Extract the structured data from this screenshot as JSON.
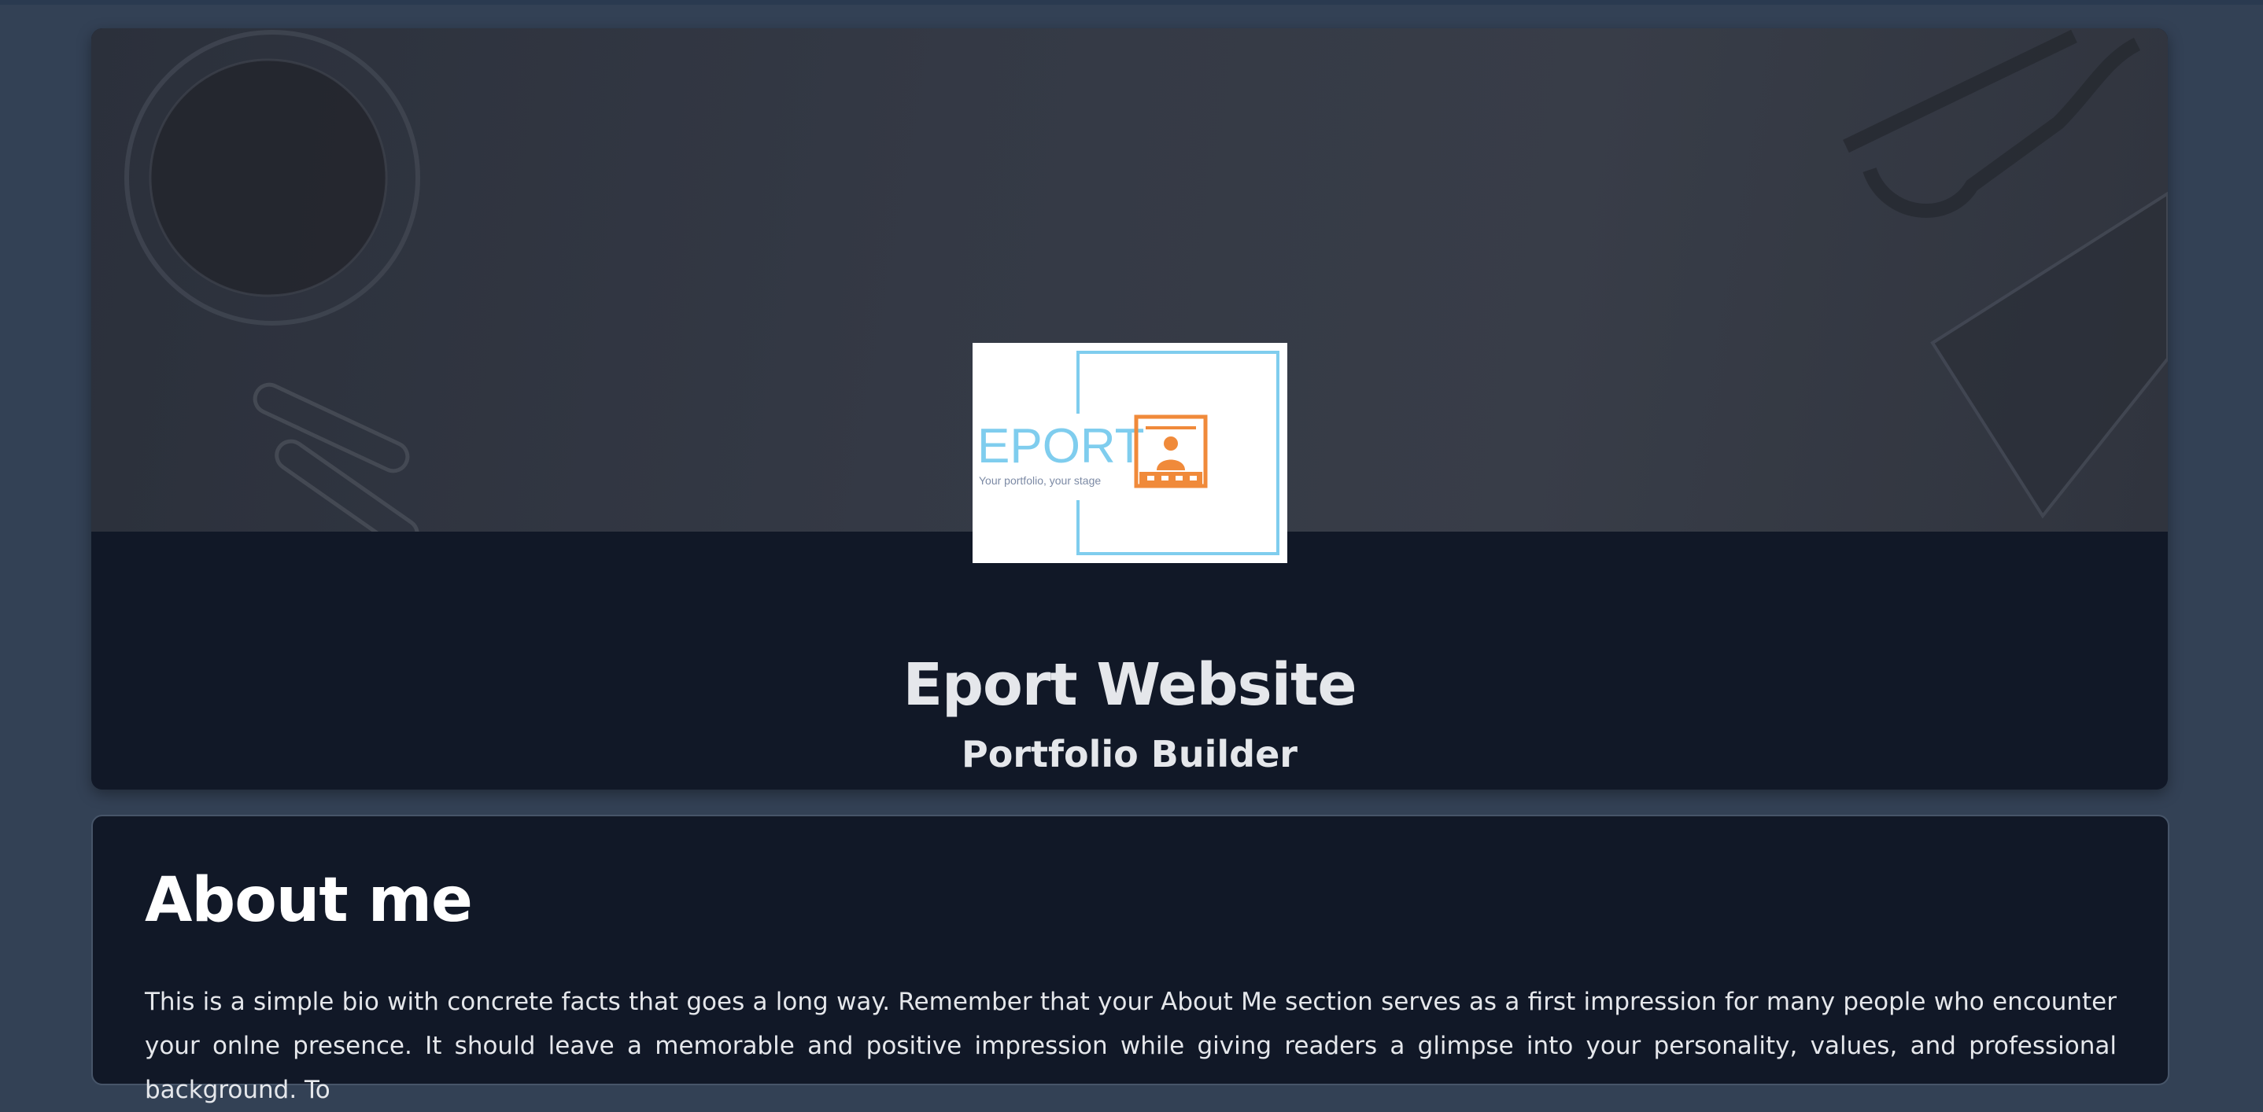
{
  "hero": {
    "title": "Eport Website",
    "subtitle": "Portfolio Builder",
    "logo": {
      "wordmark": "EPORT",
      "tagline": "Your portfolio, your stage",
      "colors": {
        "wordmark": "#7fcdee",
        "frame": "#7fcdee",
        "icon": "#f08a3a",
        "background": "#ffffff"
      }
    }
  },
  "about": {
    "heading": "About me",
    "body": "This is a simple bio with concrete facts that goes a long way. Remember that your About Me section serves as a first impression for many people who encounter your onlne presence. It should leave a memorable and positive impression while giving readers a glimpse into your personality, values, and professional background. To"
  },
  "colors": {
    "page_background": "#334155",
    "card_background": "#111827",
    "text_primary": "#e5e7eb",
    "card_border": "#475569"
  }
}
